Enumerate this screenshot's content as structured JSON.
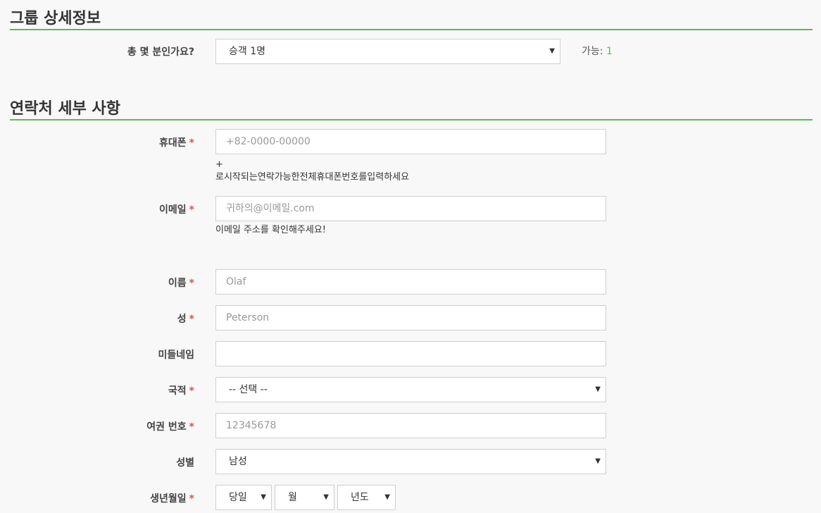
{
  "group": {
    "title": "그룹 상세정보",
    "passengers_label": "총 몇 분인가요?",
    "passengers_value": "승객 1명",
    "available_label": "가능:",
    "available_count": "1"
  },
  "contact": {
    "title": "연락처 세부 사항",
    "phone_label": "휴대폰",
    "phone_placeholder": "+82-0000-00000",
    "phone_hint_1": "+",
    "phone_hint_2": "로시작되는연락가능한전체휴대폰번호를입력하세요",
    "email_label": "이메일",
    "email_placeholder": "귀하의@이메일.com",
    "email_hint": "이메일 주소를 확인해주세요!",
    "first_name_label": "이름",
    "first_name_value": "Olaf",
    "last_name_label": "성",
    "last_name_value": "Peterson",
    "middle_name_label": "미들네임",
    "middle_name_value": "",
    "nationality_label": "국적",
    "nationality_value": "-- 선택 --",
    "passport_label": "여권 번호",
    "passport_placeholder": "12345678",
    "gender_label": "성별",
    "gender_value": "남성",
    "dob_label": "생년월일",
    "dob_day": "당일",
    "dob_month": "월",
    "dob_year": "년도"
  },
  "required_mark": "*",
  "colors": {
    "accent": "#5cb85c",
    "required": "#d9534f"
  }
}
